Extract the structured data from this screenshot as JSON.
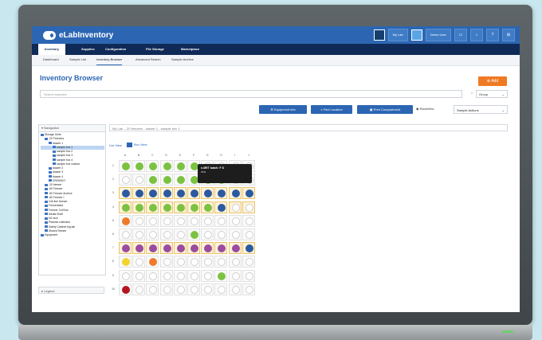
{
  "app": {
    "name": "eLabInventory",
    "brand_color": "#2c66b3",
    "nav_dark": "#0f2a57",
    "accent_orange": "#f07a24"
  },
  "topbar": {
    "lab_label": "My Lab",
    "user_label": "Demo User",
    "icons": [
      "menu-icon",
      "user-avatar",
      "layout-icon",
      "bell-icon",
      "help-icon",
      "grid-icon"
    ]
  },
  "nav": {
    "tabs": [
      {
        "label": "Inventory",
        "active": true
      },
      {
        "label": "Supplies",
        "active": false
      },
      {
        "label": "Configuration",
        "active": false
      },
      {
        "label": "File Storage",
        "active": false
      },
      {
        "label": "Marketplace",
        "active": false
      }
    ]
  },
  "subnav": {
    "items": [
      {
        "label": "Dashboard",
        "active": false
      },
      {
        "label": "Sample List",
        "active": false
      },
      {
        "label": "Inventory Browser",
        "active": true
      },
      {
        "label": "Advanced Search",
        "active": false
      },
      {
        "label": "Sample Archive",
        "active": false
      }
    ]
  },
  "page": {
    "title": "Inventory Browser",
    "add_label": "Add",
    "search_placeholder": "Search samples",
    "search_clear": "×",
    "group_label": "Group"
  },
  "actions": {
    "equipment_info": "Equipment info",
    "find_location": "Find Location",
    "print_compartment": "Print Compartment",
    "rackview": "RackView",
    "sample_actions": "Sample Actions"
  },
  "navigation_panel": {
    "title": "Navigation",
    "legend_title": "Legend",
    "tree": [
      {
        "label": "Storage Units",
        "depth": 0,
        "selected": false
      },
      {
        "label": "-20 Freezers",
        "depth": 1,
        "selected": false
      },
      {
        "label": "drawer 1",
        "depth": 2,
        "selected": false
      },
      {
        "label": "sample box 1",
        "depth": 3,
        "selected": true
      },
      {
        "label": "sample box 2",
        "depth": 3,
        "selected": false
      },
      {
        "label": "sample box 3",
        "depth": 3,
        "selected": false
      },
      {
        "label": "sample box 4",
        "depth": 3,
        "selected": false
      },
      {
        "label": "sample box custom",
        "depth": 3,
        "selected": false
      },
      {
        "label": "drawer 2",
        "depth": 2,
        "selected": false
      },
      {
        "label": "drawer 3",
        "depth": 2,
        "selected": false
      },
      {
        "label": "drawer 4",
        "depth": 2,
        "selected": false
      },
      {
        "label": "DR000007",
        "depth": 2,
        "selected": false
      },
      {
        "label": "-20 freezer",
        "depth": 1,
        "selected": false
      },
      {
        "label": "-80 Freezer",
        "depth": 1,
        "selected": false
      },
      {
        "label": "-80 Freezer Archive",
        "depth": 1,
        "selected": false
      },
      {
        "label": "-80 Freezer I",
        "depth": 1,
        "selected": false
      },
      {
        "label": "Cell line freezer",
        "depth": 1,
        "selected": false
      },
      {
        "label": "Fermentator",
        "depth": 1,
        "selected": false
      },
      {
        "label": "Freezer Cell line",
        "depth": 1,
        "selected": false
      },
      {
        "label": "Media Shelf",
        "depth": 1,
        "selected": false
      },
      {
        "label": "N2 rack",
        "depth": 1,
        "selected": false
      },
      {
        "label": "Plasmid collection",
        "depth": 1,
        "selected": false
      },
      {
        "label": "Safety Cabinet big lab",
        "depth": 1,
        "selected": false
      },
      {
        "label": "Shared freezer",
        "depth": 1,
        "selected": false
      },
      {
        "label": "Equipment",
        "depth": 0,
        "selected": false
      }
    ]
  },
  "breadcrumb": "My Lab - -20 freezers - drawer 1 - sample box 1",
  "view_tabs": {
    "list": "List View",
    "box": "Box View"
  },
  "box": {
    "columns": [
      "A",
      "B",
      "C",
      "D",
      "E",
      "F",
      "G",
      "H",
      "I",
      "J"
    ],
    "rows": [
      "1",
      "2",
      "3",
      "4",
      "5",
      "6",
      "7",
      "8",
      "9",
      "10"
    ],
    "colors": {
      "g": "#7cc242",
      "b": "#2c5aa0",
      "o": "#ef7a2a",
      "p": "#9b4c9f",
      "y": "#f2d42e",
      "r": "#b5161d",
      "w": "#ffffff"
    },
    "layout": [
      "ggggggwwww",
      "wwggggggww",
      "bbbbbbbbbb",
      "gggggggbww",
      "owwwwwwwww",
      "wwwwwgwwww",
      "pppppppppb",
      "ywowwwwwww",
      "wwwwwwwgww",
      "rwwwwwwwww"
    ],
    "highlighted_rows": [
      3,
      4,
      7
    ]
  },
  "tooltip": {
    "title": "e-MET batch: F 8",
    "subtitle": "dna"
  }
}
